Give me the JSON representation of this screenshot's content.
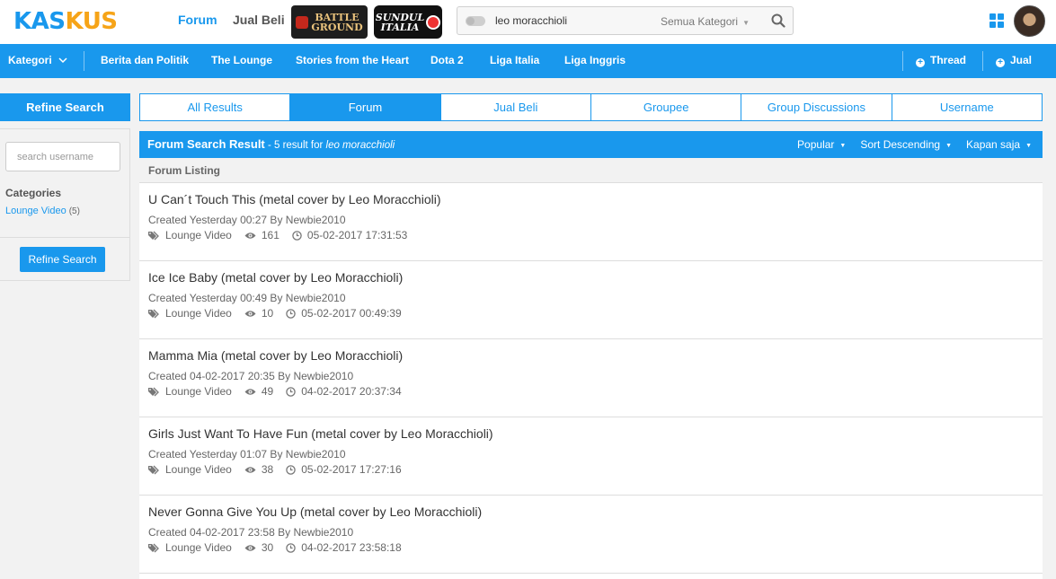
{
  "header": {
    "logo_part1": "KAS",
    "logo_part2": "KUS",
    "nav": [
      "Forum",
      "Jual Beli"
    ],
    "badge_battleground_line1": "BATTLE",
    "badge_battleground_line2": "GROUND",
    "badge_sundul_line1": "SUNDUL",
    "badge_sundul_line2": "ITALIA",
    "search_value": "leo moracchioli",
    "search_category": "Semua Kategori"
  },
  "catbar": {
    "kategori": "Kategori",
    "links": [
      "Berita dan Politik",
      "The Lounge",
      "Stories from the Heart",
      "Dota 2",
      "Liga Italia",
      "Liga Inggris"
    ],
    "thread": "Thread",
    "jual": "Jual"
  },
  "sidebar": {
    "refine_title": "Refine Search",
    "username_placeholder": "search username",
    "categories_title": "Categories",
    "category_name": "Lounge Video",
    "category_count": "(5)",
    "refine_button": "Refine Search"
  },
  "tabs": [
    "All Results",
    "Forum",
    "Jual Beli",
    "Groupee",
    "Group Discussions",
    "Username"
  ],
  "results": {
    "title": "Forum Search Result",
    "subtitle_prefix": " - 5 result for ",
    "query": "leo moracchioli",
    "sort_popular": "Popular",
    "sort_order": "Sort Descending",
    "sort_time": "Kapan saja",
    "listing_label": "Forum Listing",
    "items": [
      {
        "title": "U Can´t Touch This (metal cover by Leo Moracchioli)",
        "created": "Created Yesterday 00:27 By Newbie2010",
        "category": "Lounge Video",
        "views": "161",
        "last": "05-02-2017 17:31:53"
      },
      {
        "title": "Ice Ice Baby (metal cover by Leo Moracchioli)",
        "created": "Created Yesterday 00:49 By Newbie2010",
        "category": "Lounge Video",
        "views": "10",
        "last": "05-02-2017 00:49:39"
      },
      {
        "title": "Mamma Mia (metal cover by Leo Moracchioli)",
        "created": "Created 04-02-2017 20:35 By Newbie2010",
        "category": "Lounge Video",
        "views": "49",
        "last": "04-02-2017 20:37:34"
      },
      {
        "title": "Girls Just Want To Have Fun (metal cover by Leo Moracchioli)",
        "created": "Created Yesterday 01:07 By Newbie2010",
        "category": "Lounge Video",
        "views": "38",
        "last": "05-02-2017 17:27:16"
      },
      {
        "title": "Never Gonna Give You Up (metal cover by Leo Moracchioli)",
        "created": "Created 04-02-2017 23:58 By Newbie2010",
        "category": "Lounge Video",
        "views": "30",
        "last": "04-02-2017 23:58:18"
      }
    ]
  },
  "colors": {
    "accent": "#1998ed",
    "logo_orange": "#f6a418"
  }
}
